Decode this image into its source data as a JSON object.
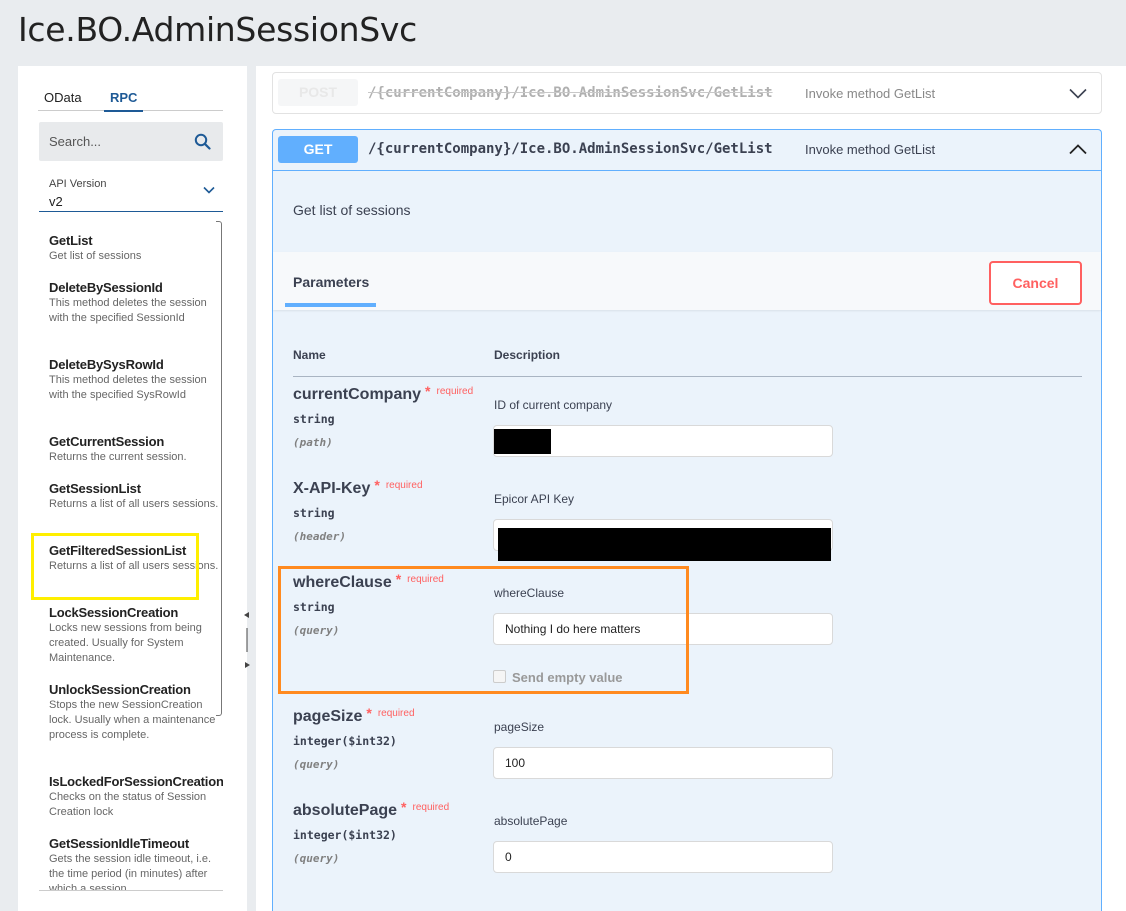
{
  "page": {
    "title": "Ice.BO.AdminSessionSvc"
  },
  "sidebar": {
    "tabs": [
      {
        "label": "OData"
      },
      {
        "label": "RPC"
      }
    ],
    "search": {
      "placeholder": "Search..."
    },
    "api_version": {
      "label": "API Version",
      "value": "v2"
    },
    "methods": [
      {
        "name": "GetList",
        "desc": "Get list of sessions"
      },
      {
        "name": "DeleteBySessionId",
        "desc": "This method deletes the session with the specified SessionId"
      },
      {
        "name": "DeleteBySysRowId",
        "desc": "This method deletes the session with the specified SysRowId"
      },
      {
        "name": "GetCurrentSession",
        "desc": "Returns the current session."
      },
      {
        "name": "GetSessionList",
        "desc": "Returns a list of all users sessions."
      },
      {
        "name": "GetFilteredSessionList",
        "desc": "Returns a list of all users sessions."
      },
      {
        "name": "LockSessionCreation",
        "desc": "Locks new sessions from being created. Usually for System Maintenance."
      },
      {
        "name": "UnlockSessionCreation",
        "desc": "Stops the new SessionCreation lock. Usually when a maintenance process is complete."
      },
      {
        "name": "IsLockedForSessionCreation",
        "desc": "Checks on the status of Session Creation lock"
      },
      {
        "name": "GetSessionIdleTimeout",
        "desc": "Gets the session idle timeout, i.e. the time period (in minutes) after which a session"
      }
    ]
  },
  "operations": {
    "post": {
      "method": "POST",
      "path": "/{currentCompany}/Ice.BO.AdminSessionSvc/GetList",
      "summary": "Invoke method GetList"
    },
    "get": {
      "method": "GET",
      "path": "/{currentCompany}/Ice.BO.AdminSessionSvc/GetList",
      "summary": "Invoke method GetList",
      "description": "Get list of sessions",
      "parameters_tab": "Parameters",
      "cancel_label": "Cancel",
      "table_headers": {
        "name": "Name",
        "description": "Description"
      },
      "required_label": "required",
      "required_star": "*",
      "params": [
        {
          "name": "currentCompany",
          "type": "string",
          "in": "(path)",
          "desc": "ID of current company",
          "value": ""
        },
        {
          "name": "X-API-Key",
          "type": "string",
          "in": "(header)",
          "desc": "Epicor API Key",
          "value": ""
        },
        {
          "name": "whereClause",
          "type": "string",
          "in": "(query)",
          "desc": "whereClause",
          "value": "Nothing I do here matters",
          "send_empty_label": "Send empty value"
        },
        {
          "name": "pageSize",
          "type": "integer($int32)",
          "in": "(query)",
          "desc": "pageSize",
          "value": "100"
        },
        {
          "name": "absolutePage",
          "type": "integer($int32)",
          "in": "(query)",
          "desc": "absolutePage",
          "value": "0"
        }
      ]
    }
  },
  "colors": {
    "get_accent": "#61affe",
    "required": "#ff6060",
    "highlight_yellow": "#ffef00",
    "highlight_orange": "#ff8a1f"
  }
}
